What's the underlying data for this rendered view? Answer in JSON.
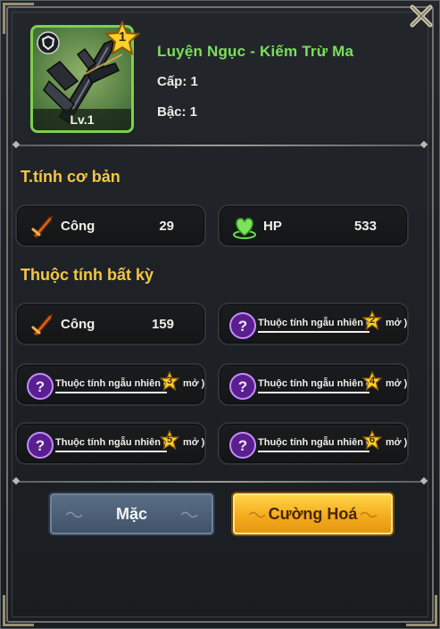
{
  "item": {
    "name": "Luyện Ngục - Kiếm Trừ Ma",
    "level_label": "Lv.1",
    "star_count": "1",
    "cap_label": "Cấp: 1",
    "bac_label": "Bậc: 1",
    "rarity_color": "#7ed14a"
  },
  "sections": {
    "basic_title": "T.tính cơ bản",
    "random_title": "Thuộc tính bất kỳ"
  },
  "basic_stats": [
    {
      "icon": "sword-icon",
      "label": "Công",
      "value": "29"
    },
    {
      "icon": "heart-icon",
      "label": "HP",
      "value": "533"
    }
  ],
  "random_stats": {
    "first": {
      "icon": "sword-icon",
      "label": "Công",
      "value": "159"
    },
    "locked": [
      {
        "icon": "question-icon",
        "label": "Thuộc tính ngẫu nhiên (",
        "star": "2",
        "suffix": "mở )"
      },
      {
        "icon": "question-icon",
        "label": "Thuộc tính ngẫu nhiên (",
        "star": "3",
        "suffix": "mở )"
      },
      {
        "icon": "question-icon",
        "label": "Thuộc tính ngẫu nhiên (",
        "star": "4",
        "suffix": "mở )"
      },
      {
        "icon": "question-icon",
        "label": "Thuộc tính ngẫu nhiên (",
        "star": "5",
        "suffix": "mở )"
      },
      {
        "icon": "question-icon",
        "label": "Thuộc tính ngẫu nhiên (",
        "star": "6",
        "suffix": "mở )"
      }
    ]
  },
  "buttons": {
    "equip": "Mặc",
    "upgrade": "Cường Hoá"
  },
  "colors": {
    "title_yellow": "#f4c743",
    "name_green": "#79e05a",
    "upgrade_gold": "#f2a81a",
    "equip_blue": "#4f6480",
    "question_purple": "#8a3fd1"
  }
}
